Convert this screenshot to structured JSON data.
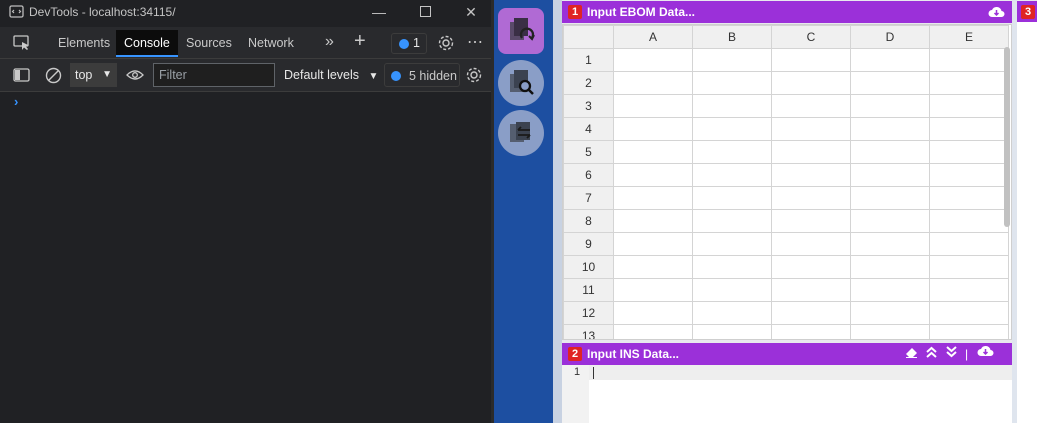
{
  "devtools": {
    "window_title": "DevTools - localhost:34115/",
    "tabs": [
      "Elements",
      "Console",
      "Sources",
      "Network"
    ],
    "active_tab": "Console",
    "issues_count": "1",
    "toolbar": {
      "context": "top",
      "filter_placeholder": "Filter",
      "levels": "Default levels",
      "hidden": "5 hidden"
    },
    "prompt_glyph": "›",
    "accent_color": "#3794ff"
  },
  "app": {
    "sidebar_color": "#1d4fa1",
    "header_color": "#9b30d9",
    "badge_color": "#e02424",
    "panel1": {
      "number": "1",
      "title": "Input EBOM Data...",
      "columns": [
        "A",
        "B",
        "C",
        "D",
        "E"
      ],
      "rows": [
        "1",
        "2",
        "3",
        "4",
        "5",
        "6",
        "7",
        "8",
        "9",
        "10",
        "11",
        "12",
        "13"
      ]
    },
    "panel2": {
      "number": "2",
      "title": "Input INS Data...",
      "line_number": "1"
    },
    "panel3": {
      "number": "3"
    }
  }
}
